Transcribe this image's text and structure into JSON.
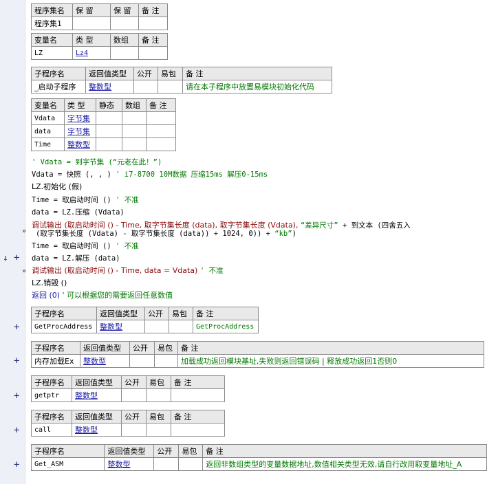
{
  "assembly_table": {
    "headers": [
      "程序集名",
      "保 留",
      "保 留",
      "备 注"
    ],
    "row": [
      "程序集1",
      "",
      "",
      ""
    ]
  },
  "var_table": {
    "headers": [
      "变量名",
      "类 型",
      "数组",
      "备 注"
    ],
    "row": [
      "LZ",
      "Lz4",
      "",
      ""
    ]
  },
  "sub_main": {
    "headers": [
      "子程序名",
      "返回值类型",
      "公开",
      "易包",
      "备 注"
    ],
    "name": "_启动子程序",
    "ret": "整数型",
    "note": "请在本子程序中放置易模块初始化代码"
  },
  "locals": {
    "headers": [
      "变量名",
      "类 型",
      "静态",
      "数组",
      "备 注"
    ],
    "rows": [
      {
        "name": "Vdata",
        "type": "字节集"
      },
      {
        "name": "data",
        "type": "字节集"
      },
      {
        "name": "Time",
        "type": "整数型"
      }
    ]
  },
  "code": {
    "l1": "' Vdata = 到字节集 (“元老在此！”)",
    "l2a": "Vdata = 快照 (, , ) ",
    "l2b": "' i7-8700 10M数据 压缩15ms 解压0-15ms",
    "l3": "LZ.初始化 (假)",
    "l4a": "Time = 取启动时间 () ",
    "l4b": "' 不准",
    "l5": "data = LZ.压缩 (Vdata)",
    "l6a": "调试输出 (取启动时间 () - Time, 取字节集长度 (data), 取字节集长度 (Vdata), ",
    "l6b": "“差异尺寸”",
    "l6c": " + 到文本 (四舍五入",
    "l7a": "(取字节集长度 (Vdata) - 取字节集长度 (data)) ÷ 1024, 0)) + ",
    "l7b": "“kb”",
    "l7c": ")",
    "l8a": "Time = 取启动时间 () ",
    "l8b": "' 不准",
    "l9": "data = LZ.解压 (data)",
    "l10a": "调试输出 (取启动时间 () - Time, data = Vdata) ",
    "l10b": "' 不准",
    "l11": "LZ.销毁 ()",
    "l12a": "返回 (0) ",
    "l12b": "' 可以根据您的需要返回任意数值"
  },
  "subs": [
    {
      "name": "GetProcAddress",
      "ret": "整数型",
      "note": "GetProcAddress"
    },
    {
      "name": "内存加载Ex",
      "ret": "整数型",
      "note": "加载成功返回模块基址,失败则返回错误码 | 释放成功返回1否则0"
    },
    {
      "name": "getptr",
      "ret": "整数型",
      "note": ""
    },
    {
      "name": "call",
      "ret": "整数型",
      "note": ""
    },
    {
      "name": "Get_ASM",
      "ret": "整数型",
      "note": "返回非数组类型的变量数据地址,数值相关类型无效,请自行改用取变量地址_A"
    }
  ],
  "sub_headers": [
    "子程序名",
    "返回值类型",
    "公开",
    "易包",
    "备 注"
  ],
  "gutter": {
    "plus": "+",
    "arrow": "↓",
    "exec": "»"
  }
}
